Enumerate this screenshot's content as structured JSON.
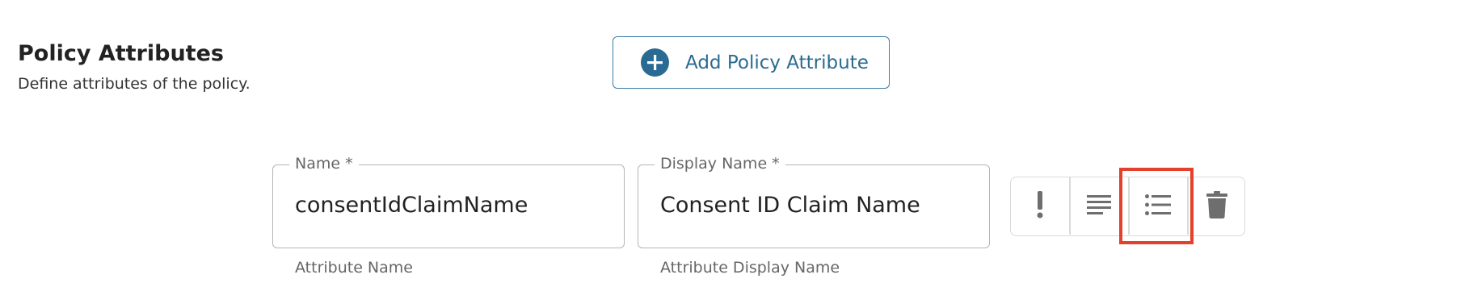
{
  "section": {
    "title": "Policy Attributes",
    "description": "Define attributes of the policy."
  },
  "add_button": {
    "label": "Add Policy Attribute",
    "icon": "plus-circle-icon",
    "color": "#2a6b93"
  },
  "fields": {
    "name": {
      "label": "Name *",
      "value": "consentIdClaimName",
      "helper": "Attribute Name"
    },
    "display_name": {
      "label": "Display Name *",
      "value": "Consent ID Claim Name",
      "helper": "Attribute Display Name"
    }
  },
  "actions": [
    {
      "icon": "exclamation-icon",
      "name": "required-toggle"
    },
    {
      "icon": "text-lines-icon",
      "name": "text-type-toggle"
    },
    {
      "icon": "list-icon",
      "name": "list-type-toggle",
      "highlighted": true
    },
    {
      "icon": "trash-icon",
      "name": "delete"
    }
  ],
  "colors": {
    "highlight": "#e3412b",
    "icon": "#6e6e6e",
    "border": "#b5b5b5"
  }
}
